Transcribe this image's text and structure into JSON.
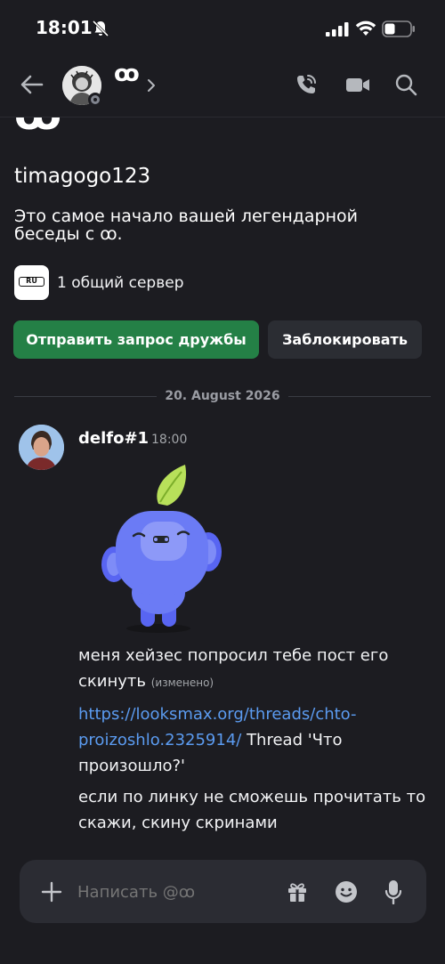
{
  "status_bar": {
    "time": "18:01"
  },
  "header": {
    "name": "ꝏ"
  },
  "intro": {
    "big_name": "ꝏ",
    "username": "timagogo123",
    "text": "Это самое начало вашей легендарной беседы с ꝏ."
  },
  "mutual": {
    "server_tag": "RU",
    "text": "1 общий сервер"
  },
  "actions": {
    "add_friend": "Отправить запрос дружбы",
    "block": "Заблокировать"
  },
  "date_divider": "20. August 2026",
  "message": {
    "author": "delfo#1",
    "time": "18:00",
    "line1": "меня хейзес попросил тебе пост его скинуть",
    "edited": "(изменено)",
    "link": "https://looksmax.org/threads/chto-proizoshlo.2325914/",
    "link_suffix": " Thread 'Что произошло?'",
    "line3": "если по линку не сможешь прочитать то скажи, скину скринами"
  },
  "composer": {
    "placeholder": "Написать @ꝏ"
  },
  "colors": {
    "accent_green": "#248046",
    "link": "#5b9bf0",
    "background": "#1c1c21"
  }
}
